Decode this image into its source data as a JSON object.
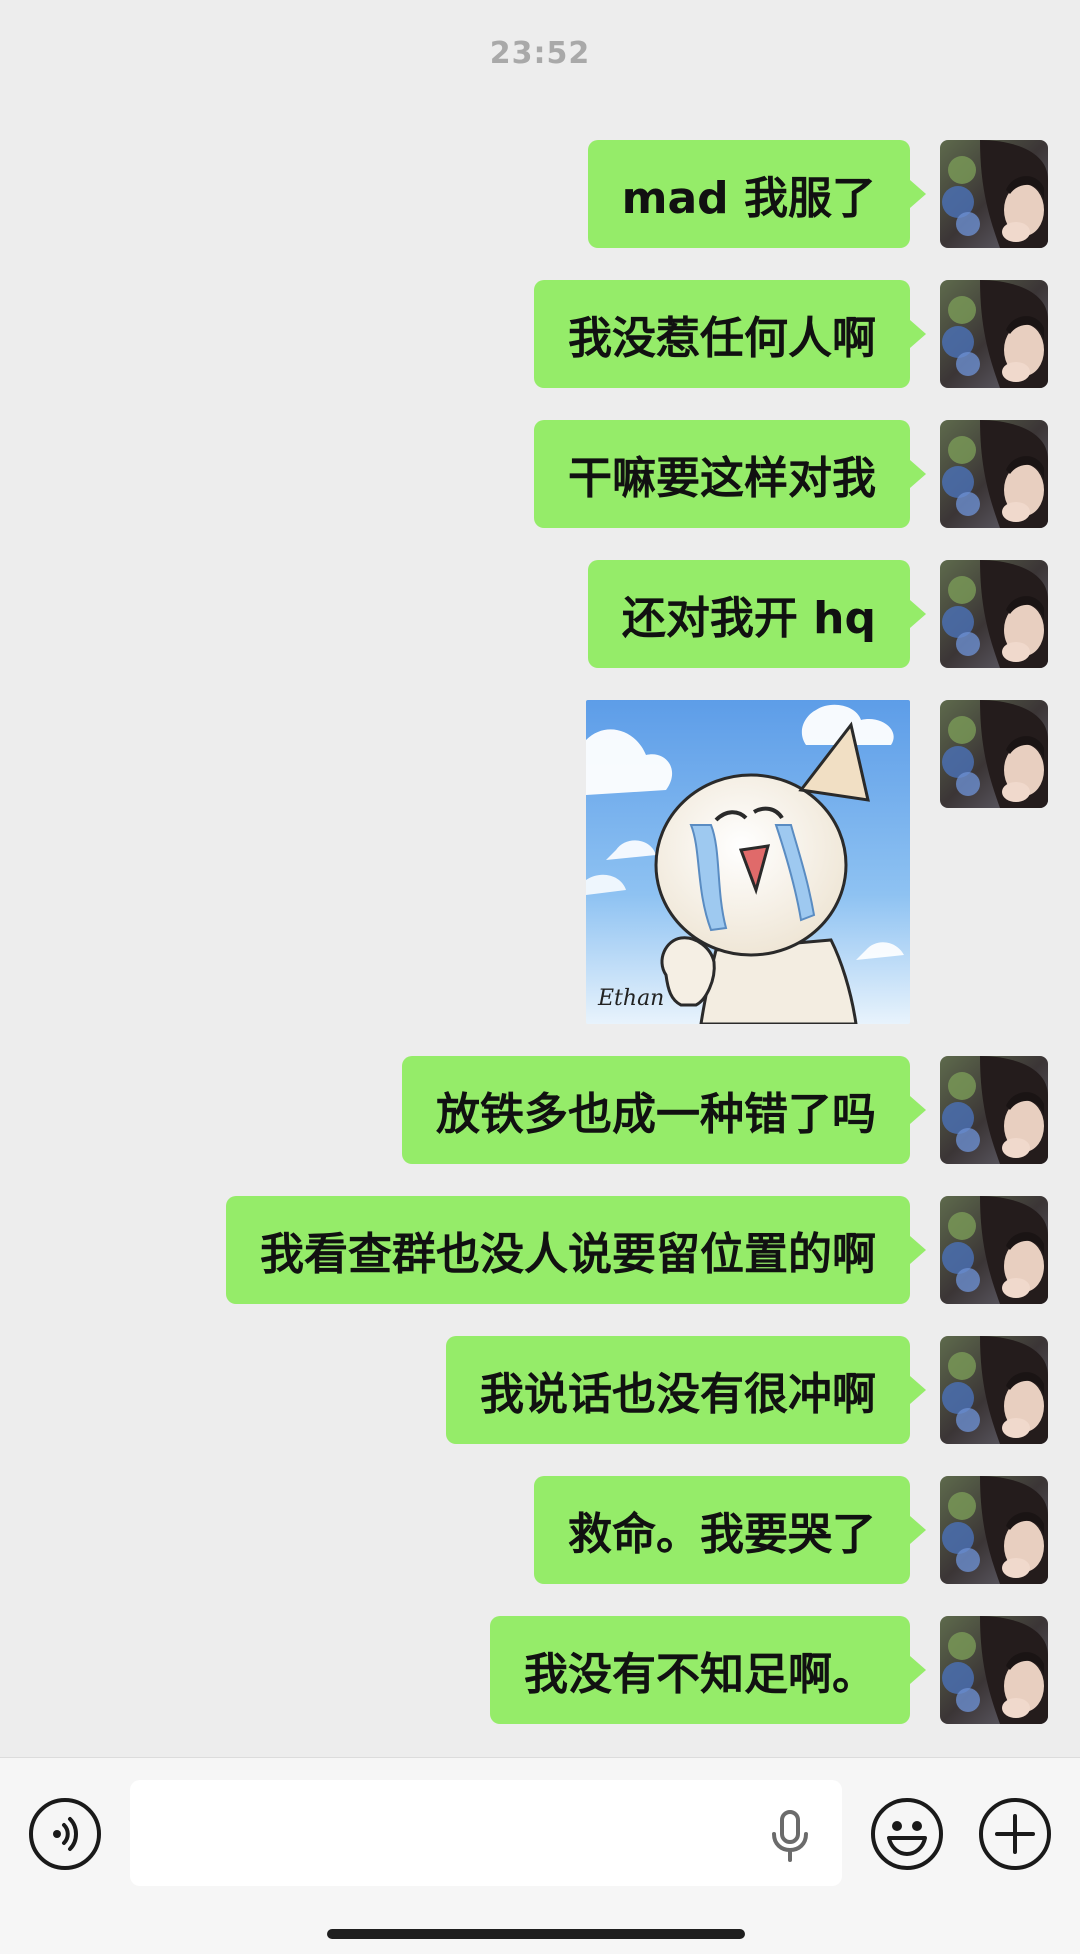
{
  "timestamp": "23:52",
  "messages": [
    {
      "type": "text",
      "text": "mad 我服了"
    },
    {
      "type": "text",
      "text": "我没惹任何人啊"
    },
    {
      "type": "text",
      "text": "干嘛要这样对我"
    },
    {
      "type": "text",
      "text": "还对我开 hq"
    },
    {
      "type": "sticker",
      "icon": "crying-cartoon-sticker"
    },
    {
      "type": "text",
      "text": "放铁多也成一种错了吗"
    },
    {
      "type": "text",
      "text": "我看查群也没人说要留位置的啊"
    },
    {
      "type": "text",
      "text": "我说话也没有很冲啊"
    },
    {
      "type": "text",
      "text": "救命。我要哭了"
    },
    {
      "type": "text",
      "text": "我没有不知足啊。"
    }
  ],
  "input_bar": {
    "voice_icon": "voice-mode-icon",
    "text_value": "",
    "mic_icon": "microphone-icon",
    "emoji_icon": "emoji-smile-icon",
    "more_icon": "plus-icon"
  },
  "colors": {
    "background": "#ededed",
    "bubble": "#95ec69",
    "text": "#111111",
    "timestamp": "#a9a9a9",
    "input_bar": "#f6f6f6"
  }
}
